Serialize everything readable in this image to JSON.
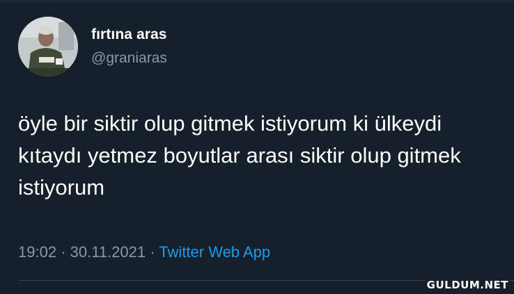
{
  "tweet": {
    "author": {
      "name": "fırtına aras",
      "handle": "@graniaras"
    },
    "text": "öyle bir siktir olup gitmek istiyorum ki ülkeydi kıtaydı yetmez boyutlar arası siktir olup gitmek istiyorum",
    "time": "19:02",
    "date": "30.11.2021",
    "separator": "·",
    "source": "Twitter Web App"
  },
  "watermark": "GULDUM.NET",
  "colors": {
    "background": "#15202b",
    "text": "#ffffff",
    "muted": "#8b98a5",
    "accent": "#1d9bf0"
  }
}
